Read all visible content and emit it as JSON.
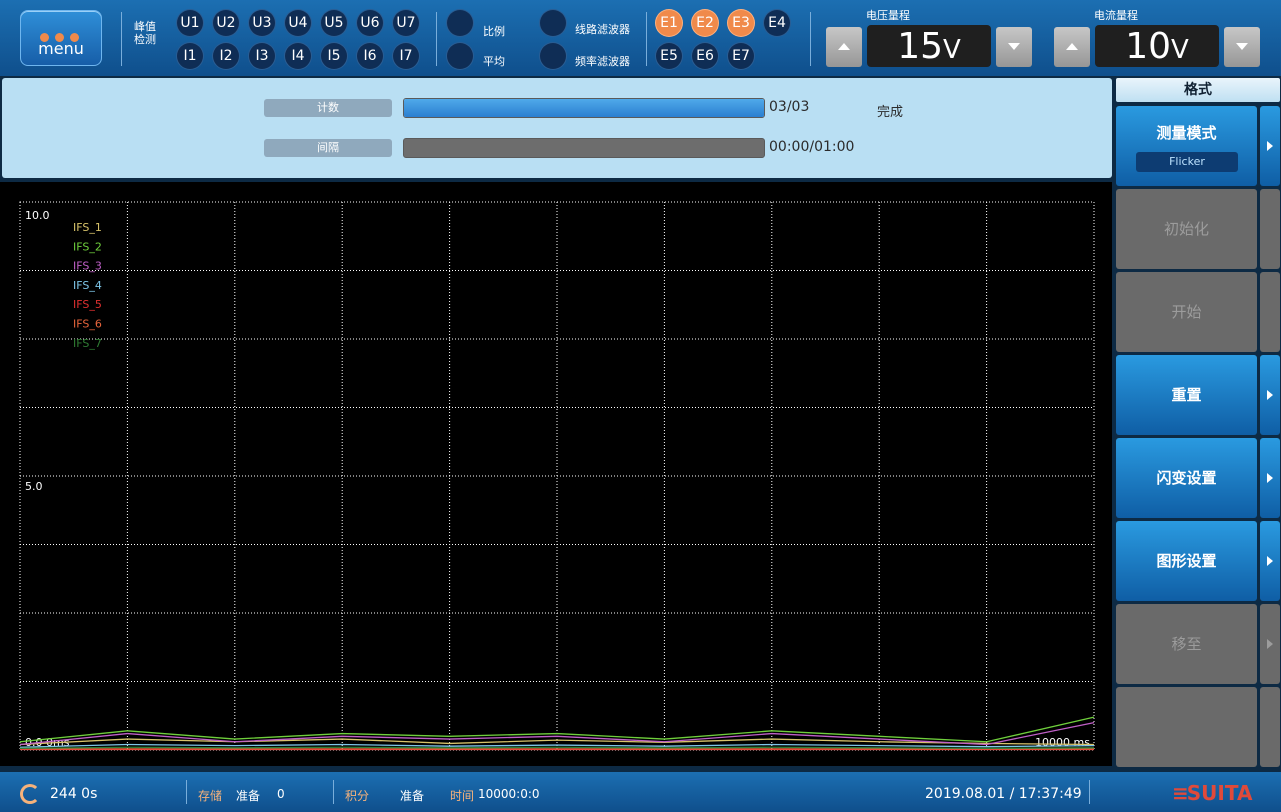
{
  "topbar": {
    "menu_label": "menu",
    "peak_label_1": "峰值",
    "peak_label_2": "检测",
    "channels_u": [
      "U1",
      "U2",
      "U3",
      "U4",
      "U5",
      "U6",
      "U7"
    ],
    "channels_i": [
      "I1",
      "I2",
      "I3",
      "I4",
      "I5",
      "I6",
      "I7"
    ],
    "toggles": {
      "ratio": "比例",
      "average": "平均",
      "line_filter": "线路滤波器",
      "freq_filter": "频率滤波器"
    },
    "elements_top": [
      {
        "label": "E1",
        "active": true
      },
      {
        "label": "E2",
        "active": true
      },
      {
        "label": "E3",
        "active": true
      },
      {
        "label": "E4",
        "active": false
      }
    ],
    "elements_bottom": [
      {
        "label": "E5",
        "active": false
      },
      {
        "label": "E6",
        "active": false
      },
      {
        "label": "E7",
        "active": false
      }
    ],
    "voltage_range": {
      "title": "电压量程",
      "value": "15",
      "unit": "V"
    },
    "current_range": {
      "title": "电流量程",
      "value": "10",
      "unit": "V"
    }
  },
  "progress": {
    "count_label": "计数",
    "count_value": "03/03",
    "count_fraction": 1.0,
    "status": "完成",
    "interval_label": "间隔",
    "interval_value": "00:00/01:00",
    "interval_fraction": 0.0
  },
  "chart_data": {
    "type": "line",
    "y_tick_top": "10.0",
    "y_tick_mid": "5.0",
    "x_start_label": "0.0  0ms",
    "x_end_label": "10000 ms",
    "xlim": [
      0,
      10000
    ],
    "ylim": [
      0,
      10
    ],
    "grid": true,
    "series": [
      {
        "name": "IFS_1",
        "color": "#d8c36a",
        "values": [
          0.1,
          0.2,
          0.15,
          0.2,
          0.12,
          0.18,
          0.14,
          0.2,
          0.15,
          0.12,
          0.1
        ]
      },
      {
        "name": "IFS_2",
        "color": "#6fcf3c",
        "values": [
          0.15,
          0.35,
          0.2,
          0.3,
          0.25,
          0.3,
          0.2,
          0.35,
          0.25,
          0.15,
          0.6
        ]
      },
      {
        "name": "IFS_3",
        "color": "#c060c8",
        "values": [
          0.1,
          0.3,
          0.15,
          0.25,
          0.2,
          0.25,
          0.15,
          0.3,
          0.2,
          0.1,
          0.5
        ]
      },
      {
        "name": "IFS_4",
        "color": "#7ec6e8",
        "values": [
          0.05,
          0.1,
          0.08,
          0.1,
          0.07,
          0.09,
          0.07,
          0.1,
          0.08,
          0.06,
          0.08
        ]
      },
      {
        "name": "IFS_5",
        "color": "#e03030",
        "values": [
          0.01,
          0.01,
          0.01,
          0.01,
          0.01,
          0.01,
          0.01,
          0.01,
          0.01,
          0.01,
          0.01
        ]
      },
      {
        "name": "IFS_6",
        "color": "#e8653c",
        "values": [
          0.02,
          0.02,
          0.02,
          0.02,
          0.02,
          0.02,
          0.02,
          0.02,
          0.02,
          0.02,
          0.02
        ]
      },
      {
        "name": "IFS_7",
        "color": "#2f7d33",
        "values": [
          0.03,
          0.05,
          0.04,
          0.05,
          0.04,
          0.05,
          0.04,
          0.05,
          0.04,
          0.03,
          0.04
        ]
      }
    ],
    "x": [
      0,
      1000,
      2000,
      3000,
      4000,
      5000,
      6000,
      7000,
      8000,
      9000,
      10000
    ]
  },
  "sidebar": {
    "title": "格式",
    "measure_mode": "测量模式",
    "measure_mode_value": "Flicker",
    "init": "初始化",
    "start": "开始",
    "reset": "重置",
    "flicker_settings": "闪变设置",
    "graph_settings": "图形设置",
    "move_to": "移至"
  },
  "status": {
    "elapsed": "244 0s",
    "store_label": "存储",
    "store_state": "准备",
    "store_count": "0",
    "integ_label": "积分",
    "integ_state": "准备",
    "time_label": "时间",
    "time_value": "10000:0:0",
    "datetime": "2019.08.01 / 17:37:49",
    "brand": "SUITA"
  },
  "colors": {
    "accent": "#f08a4b",
    "panel": "#b9dff3",
    "bar": "#2b7fd0"
  }
}
